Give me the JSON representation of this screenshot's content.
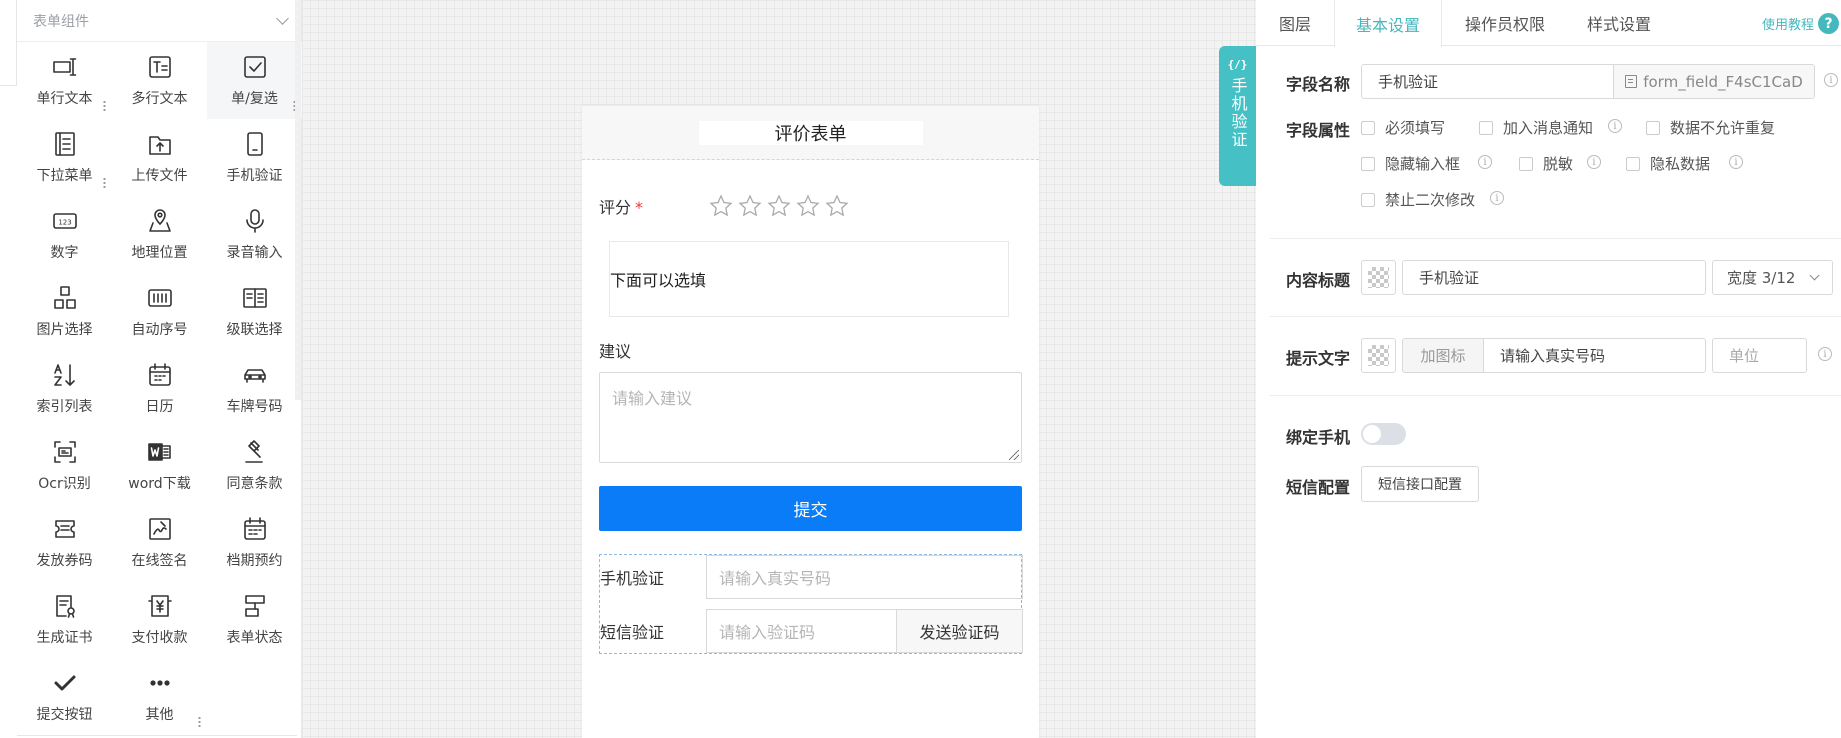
{
  "palette": {
    "group_title": "表单组件",
    "items": [
      {
        "label": "单行文本",
        "icon": "single-line-text-icon"
      },
      {
        "label": "多行文本",
        "icon": "multi-line-text-icon"
      },
      {
        "label": "单/复选",
        "icon": "checkbox-icon"
      },
      {
        "label": "下拉菜单",
        "icon": "dropdown-list-icon"
      },
      {
        "label": "上传文件",
        "icon": "upload-file-icon"
      },
      {
        "label": "手机验证",
        "icon": "mobile-phone-icon"
      },
      {
        "label": "数字",
        "icon": "number-123-icon"
      },
      {
        "label": "地理位置",
        "icon": "map-location-icon"
      },
      {
        "label": "录音输入",
        "icon": "microphone-icon"
      },
      {
        "label": "图片选择",
        "icon": "image-grid-icon"
      },
      {
        "label": "自动序号",
        "icon": "auto-number-icon"
      },
      {
        "label": "级联选择",
        "icon": "cascade-select-icon"
      },
      {
        "label": "索引列表",
        "icon": "az-sort-icon"
      },
      {
        "label": "日历",
        "icon": "calendar-icon"
      },
      {
        "label": "车牌号码",
        "icon": "car-icon"
      },
      {
        "label": "Ocr识别",
        "icon": "ocr-scan-icon"
      },
      {
        "label": "word下载",
        "icon": "word-document-icon"
      },
      {
        "label": "同意条款",
        "icon": "gavel-icon"
      },
      {
        "label": "发放券码",
        "icon": "coupon-ticket-icon"
      },
      {
        "label": "在线签名",
        "icon": "signature-icon"
      },
      {
        "label": "档期预约",
        "icon": "schedule-calendar-icon"
      },
      {
        "label": "生成证书",
        "icon": "certificate-icon"
      },
      {
        "label": "支付收款",
        "icon": "payment-yuan-icon"
      },
      {
        "label": "表单状态",
        "icon": "form-status-icon"
      },
      {
        "label": "提交按钮",
        "icon": "checkmark-icon"
      },
      {
        "label": "其他",
        "icon": "more-dots-icon"
      }
    ]
  },
  "form": {
    "title": "评价表单",
    "rating_label": "评分",
    "required_mark": "*",
    "star_count": 5,
    "note_text": "下面可以选填",
    "suggestion_label": "建议",
    "suggestion_placeholder": "请输入建议",
    "submit_label": "提交",
    "phone_label": "手机验证",
    "phone_placeholder": "请输入真实号码",
    "sms_label": "短信验证",
    "sms_placeholder": "请输入验证码",
    "send_code_label": "发送验证码"
  },
  "side_tab": {
    "code": "{/}",
    "text": "手机验证"
  },
  "settings": {
    "tabs": [
      "图层",
      "基本设置",
      "操作员权限",
      "样式设置"
    ],
    "active_tab": "基本设置",
    "tutorial_label": "使用教程",
    "tutorial_icon": "?",
    "field_name_label": "字段名称",
    "field_name_value": "手机验证",
    "field_id": "form_field_F4sC1CaD",
    "field_attr_label": "字段属性",
    "attrs": {
      "required": "必须填写",
      "notify": "加入消息通知",
      "no_duplicate": "数据不允许重复",
      "hide_input": "隐藏输入框",
      "desensitize": "脱敏",
      "private": "隐私数据",
      "no_edit": "禁止二次修改"
    },
    "content_title_label": "内容标题",
    "content_title_value": "手机验证",
    "width_select": "宽度 3/12",
    "hint_label": "提示文字",
    "add_icon_label": "加图标",
    "hint_value": "请输入真实号码",
    "unit_placeholder": "单位",
    "bind_phone_label": "绑定手机",
    "bind_phone_on": false,
    "sms_config_label": "短信配置",
    "sms_config_button": "短信接口配置",
    "info_glyph": "i"
  },
  "colors": {
    "accent": "#45b8bd",
    "teal_tab": "#45c1c5",
    "submit_blue": "#0a7cf7",
    "required_red": "#e4393c"
  }
}
